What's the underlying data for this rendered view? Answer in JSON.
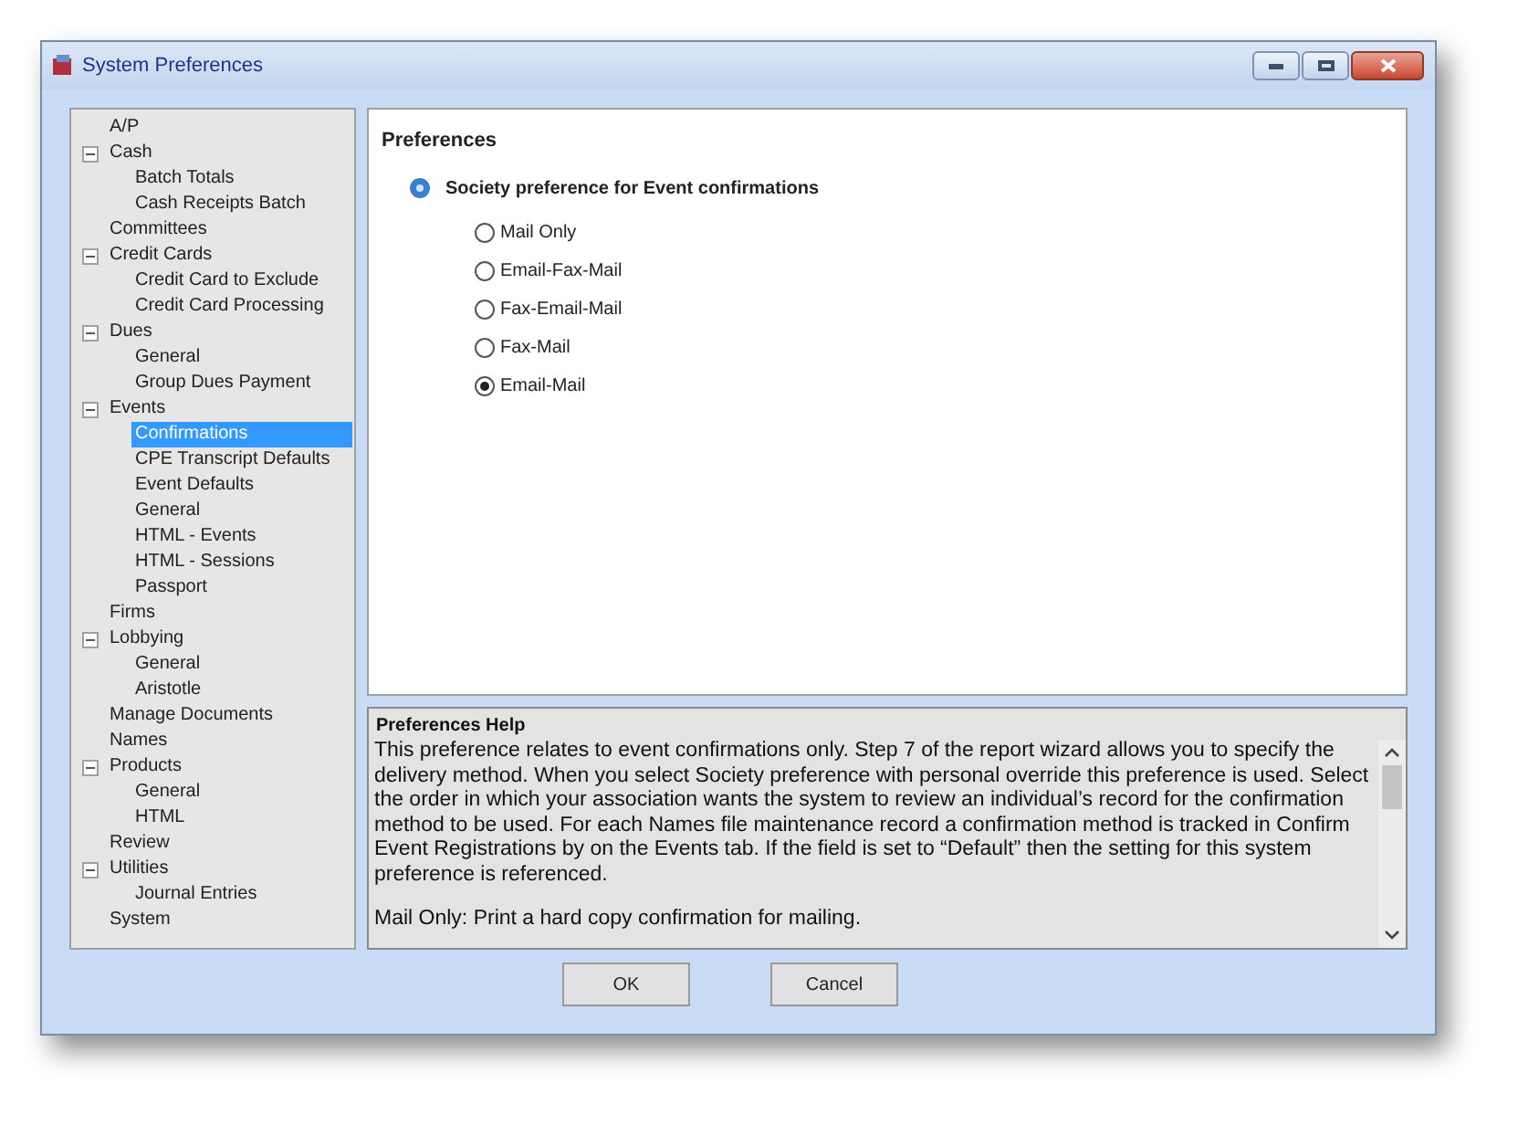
{
  "window": {
    "title": "System Preferences"
  },
  "tree": [
    {
      "label": "A/P",
      "selected": false
    },
    {
      "label": "Cash",
      "expanded": true,
      "selected": false,
      "children": [
        {
          "label": "Batch Totals",
          "selected": false
        },
        {
          "label": "Cash Receipts Batch",
          "selected": false
        }
      ]
    },
    {
      "label": "Committees",
      "selected": false
    },
    {
      "label": "Credit Cards",
      "expanded": true,
      "selected": false,
      "children": [
        {
          "label": "Credit Card to Exclude",
          "selected": false
        },
        {
          "label": "Credit Card Processing",
          "selected": false
        }
      ]
    },
    {
      "label": "Dues",
      "expanded": true,
      "selected": false,
      "children": [
        {
          "label": "General",
          "selected": false
        },
        {
          "label": "Group Dues Payment",
          "selected": false
        }
      ]
    },
    {
      "label": "Events",
      "expanded": true,
      "selected": false,
      "children": [
        {
          "label": "Confirmations",
          "selected": true
        },
        {
          "label": "CPE Transcript Defaults",
          "selected": false
        },
        {
          "label": "Event Defaults",
          "selected": false
        },
        {
          "label": "General",
          "selected": false
        },
        {
          "label": "HTML - Events",
          "selected": false
        },
        {
          "label": "HTML - Sessions",
          "selected": false
        },
        {
          "label": "Passport",
          "selected": false
        }
      ]
    },
    {
      "label": "Firms",
      "selected": false
    },
    {
      "label": "Lobbying",
      "expanded": true,
      "selected": false,
      "children": [
        {
          "label": "General",
          "selected": false
        },
        {
          "label": "Aristotle",
          "selected": false
        }
      ]
    },
    {
      "label": "Manage Documents",
      "selected": false
    },
    {
      "label": "Names",
      "selected": false
    },
    {
      "label": "Products",
      "expanded": true,
      "selected": false,
      "children": [
        {
          "label": "General",
          "selected": false
        },
        {
          "label": "HTML",
          "selected": false
        }
      ]
    },
    {
      "label": "Review",
      "selected": false
    },
    {
      "label": "Utilities",
      "expanded": true,
      "selected": false,
      "children": [
        {
          "label": "Journal Entries",
          "selected": false
        }
      ]
    },
    {
      "label": "System",
      "selected": false
    }
  ],
  "preferences": {
    "title": "Preferences",
    "question": "Society preference for Event confirmations",
    "options": [
      {
        "label": "Mail Only",
        "selected": false
      },
      {
        "label": "Email-Fax-Mail",
        "selected": false
      },
      {
        "label": "Fax-Email-Mail",
        "selected": false
      },
      {
        "label": "Fax-Mail",
        "selected": false
      },
      {
        "label": "Email-Mail",
        "selected": true
      }
    ]
  },
  "help": {
    "title": "Preferences Help",
    "paragraphs": [
      "This preference relates to event confirmations only.  Step 7 of the report wizard allows you to specify the delivery method.  When you select Society preference with personal override this preference is used.  Select the order in which your association wants the system to review an individual’s record for the confirmation method to be used.  For each Names file maintenance record a confirmation method is tracked in Confirm Event Registrations by on the Events tab.  If the field is set to “Default” then the setting for this system preference is referenced.",
      "Mail Only:  Print a hard copy confirmation for mailing."
    ]
  },
  "buttons": [
    "OK",
    "Cancel"
  ]
}
